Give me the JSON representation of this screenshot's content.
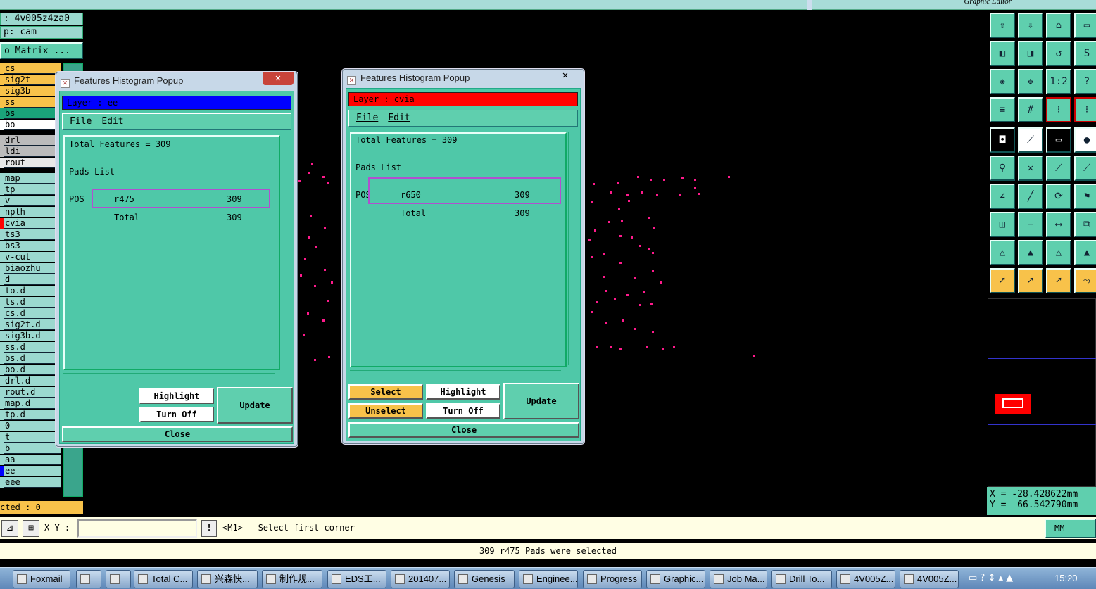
{
  "top": {
    "job_label": ": 4v005z4za0",
    "step_label": "p: cam",
    "matrix_label": "o Matrix ...",
    "graphic_editor_title": "Graphic Editor"
  },
  "layers": [
    {
      "name": "cs",
      "color": "#f8c24a",
      "strip": "#f8c24a"
    },
    {
      "name": "sig2t",
      "color": "#f8c24a",
      "strip": "#f8c24a"
    },
    {
      "name": "sig3b",
      "color": "#f8c24a",
      "strip": "#f8c24a"
    },
    {
      "name": "ss",
      "color": "#f8c24a",
      "strip": "#f8c24a"
    },
    {
      "name": "bs",
      "color": "#1aa37a",
      "strip": "#1aa37a"
    },
    {
      "name": "bo",
      "color": "#ffffff",
      "strip": "#ffffff"
    },
    {
      "name": "drl",
      "color": "#bbbbbb",
      "strip": "#bbbbbb"
    },
    {
      "name": "ldi",
      "color": "#bbbbbb",
      "strip": "#bbbbbb"
    },
    {
      "name": "rout",
      "color": "#e8e8e8",
      "strip": "#e8e8e8"
    },
    {
      "name": "map",
      "color": "#9bd8cf",
      "strip": "#9bd8cf"
    },
    {
      "name": "tp",
      "color": "#9bd8cf",
      "strip": "#9bd8cf"
    },
    {
      "name": "v",
      "color": "#9bd8cf",
      "strip": "#9bd8cf"
    },
    {
      "name": "npth",
      "color": "#9bd8cf",
      "strip": "#9bd8cf"
    },
    {
      "name": "cvia",
      "color": "#9bd8cf",
      "strip": "#ff0000"
    },
    {
      "name": "ts3",
      "color": "#9bd8cf",
      "strip": "#9bd8cf"
    },
    {
      "name": "bs3",
      "color": "#9bd8cf",
      "strip": "#9bd8cf"
    },
    {
      "name": "v-cut",
      "color": "#9bd8cf",
      "strip": "#9bd8cf"
    },
    {
      "name": "biaozhu",
      "color": "#9bd8cf",
      "strip": "#9bd8cf"
    },
    {
      "name": "d",
      "color": "#9bd8cf",
      "strip": "#9bd8cf"
    },
    {
      "name": "to.d",
      "color": "#9bd8cf",
      "strip": "#9bd8cf"
    },
    {
      "name": "ts.d",
      "color": "#9bd8cf",
      "strip": "#9bd8cf"
    },
    {
      "name": "cs.d",
      "color": "#9bd8cf",
      "strip": "#9bd8cf"
    },
    {
      "name": "sig2t.d",
      "color": "#9bd8cf",
      "strip": "#9bd8cf"
    },
    {
      "name": "sig3b.d",
      "color": "#9bd8cf",
      "strip": "#9bd8cf"
    },
    {
      "name": "ss.d",
      "color": "#9bd8cf",
      "strip": "#9bd8cf"
    },
    {
      "name": "bs.d",
      "color": "#9bd8cf",
      "strip": "#9bd8cf"
    },
    {
      "name": "bo.d",
      "color": "#9bd8cf",
      "strip": "#9bd8cf"
    },
    {
      "name": "drl.d",
      "color": "#9bd8cf",
      "strip": "#9bd8cf"
    },
    {
      "name": "rout.d",
      "color": "#9bd8cf",
      "strip": "#9bd8cf"
    },
    {
      "name": "map.d",
      "color": "#9bd8cf",
      "strip": "#9bd8cf"
    },
    {
      "name": "tp.d",
      "color": "#9bd8cf",
      "strip": "#9bd8cf"
    },
    {
      "name": "0",
      "color": "#9bd8cf",
      "strip": "#9bd8cf"
    },
    {
      "name": "t",
      "color": "#9bd8cf",
      "strip": "#9bd8cf"
    },
    {
      "name": "b",
      "color": "#9bd8cf",
      "strip": "#9bd8cf"
    },
    {
      "name": "aa",
      "color": "#9bd8cf",
      "strip": "#9bd8cf"
    },
    {
      "name": "ee",
      "color": "#9bd8cf",
      "strip": "#0000ff"
    },
    {
      "name": "eee",
      "color": "#9bd8cf",
      "strip": "#9bd8cf"
    }
  ],
  "selected_count": "cted : 0",
  "popup1": {
    "title": "Features Histogram Popup",
    "layer": "Layer :  ee",
    "layer_color": "#0000ff",
    "menu_file": "File",
    "menu_edit": "Edit",
    "total": "Total Features = 309",
    "pads_list": "Pads List",
    "dashes": "---------",
    "row_pol": "POS",
    "row_sym": "r475",
    "row_count": "309",
    "total_label": "Total",
    "total_count": "309",
    "highlight": "Highlight",
    "turn_off": "Turn Off",
    "update": "Update",
    "close": "Close"
  },
  "popup2": {
    "title": "Features Histogram Popup",
    "layer": "Layer :  cvia",
    "layer_color": "#ff0000",
    "menu_file": "File",
    "menu_edit": "Edit",
    "total": "Total Features = 309",
    "pads_list": "Pads List",
    "dashes": "---------",
    "row_pol": "POS",
    "row_sym": "r650",
    "row_count": "309",
    "total_label": "Total",
    "total_count": "309",
    "select": "Select",
    "unselect": "Unselect",
    "highlight": "Highlight",
    "turn_off": "Turn Off",
    "update": "Update",
    "close": "Close"
  },
  "coords": {
    "x": "X = -28.428622mm",
    "y": "Y =  66.542790mm"
  },
  "cmdbar": {
    "xy_label": "X Y :",
    "xy_value": "",
    "prompt": "<M1> - Select first corner",
    "units": "MM"
  },
  "status": "309 r475 Pads were selected",
  "taskbar": {
    "items": [
      "Foxmail",
      "",
      "",
      "Total C...",
      "兴森快...",
      "制作规...",
      "EDS工...",
      "201407...",
      "Genesis",
      "Enginee...",
      "Progress",
      "Graphic...",
      "Job Ma...",
      "Drill To...",
      "4V005Z...",
      "4V005Z..."
    ],
    "clock": "15:20"
  }
}
